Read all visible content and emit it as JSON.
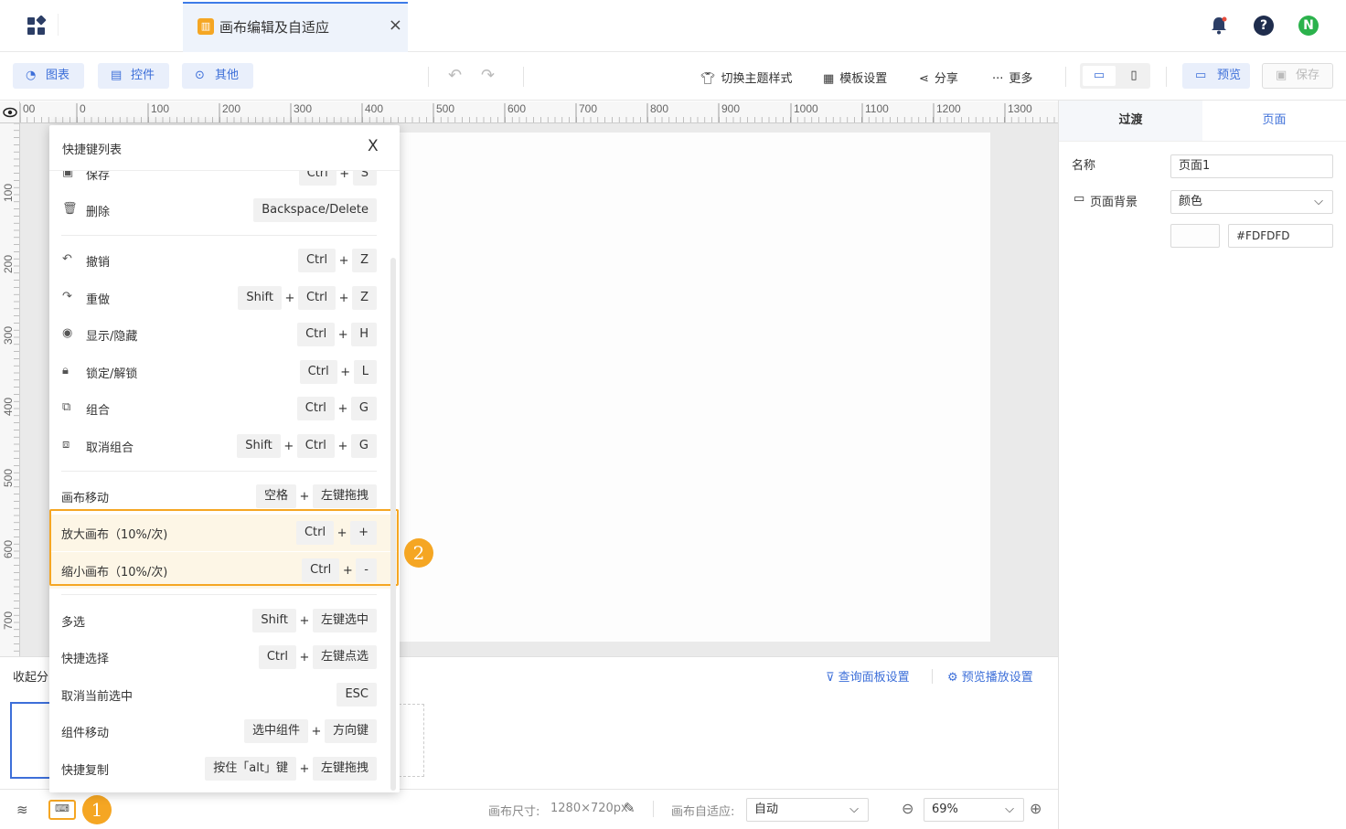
{
  "tab": {
    "title": "画布编辑及自适应",
    "close": "×"
  },
  "header_icons": {
    "user_initial": "N"
  },
  "toolbar": {
    "chart": "图表",
    "widget": "控件",
    "other": "其他",
    "theme": "切换主题样式",
    "template": "模板设置",
    "share": "分享",
    "more": "更多",
    "preview": "预览",
    "save": "保存"
  },
  "ruler": {
    "h_labels": [
      "00",
      "0",
      "100",
      "200",
      "300",
      "400",
      "500",
      "600",
      "700",
      "800",
      "900",
      "1000",
      "1100",
      "1200",
      "1300"
    ],
    "v_labels": [
      "100",
      "200",
      "300",
      "400",
      "500",
      "600",
      "700"
    ]
  },
  "popup": {
    "title": "快捷键列表",
    "close": "X",
    "rows": [
      {
        "label": "保存",
        "keys": [
          "Ctrl",
          "S"
        ]
      },
      {
        "label": "删除",
        "keys": [
          "Backspace/Delete"
        ]
      },
      {
        "label": "撤销",
        "keys": [
          "Ctrl",
          "Z"
        ]
      },
      {
        "label": "重做",
        "keys": [
          "Shift",
          "Ctrl",
          "Z"
        ]
      },
      {
        "label": "显示/隐藏",
        "keys": [
          "Ctrl",
          "H"
        ]
      },
      {
        "label": "锁定/解锁",
        "keys": [
          "Ctrl",
          "L"
        ]
      },
      {
        "label": "组合",
        "keys": [
          "Ctrl",
          "G"
        ]
      },
      {
        "label": "取消组合",
        "keys": [
          "Shift",
          "Ctrl",
          "G"
        ]
      },
      {
        "label": "画布移动",
        "keys": [
          "空格",
          "左键拖拽"
        ]
      },
      {
        "label": "放大画布（10%/次)",
        "keys": [
          "Ctrl",
          "+"
        ]
      },
      {
        "label": "缩小画布（10%/次)",
        "keys": [
          "Ctrl",
          "-"
        ]
      },
      {
        "label": "多选",
        "keys": [
          "Shift",
          "左键选中"
        ]
      },
      {
        "label": "快捷选择",
        "keys": [
          "Ctrl",
          "左键点选"
        ]
      },
      {
        "label": "取消当前选中",
        "keys": [
          "ESC"
        ]
      },
      {
        "label": "组件移动",
        "keys": [
          "选中组件",
          "方向键"
        ]
      },
      {
        "label": "快捷复制",
        "keys": [
          "按住「alt」键",
          "左键拖拽"
        ]
      }
    ],
    "plus": "+"
  },
  "badges": {
    "one": "1",
    "two": "2"
  },
  "page_panel": {
    "collapse": "收起分",
    "query_settings": "查询面板设置",
    "playback_settings": "预览播放设置"
  },
  "bottom_bar": {
    "canvas_size_label": "画布尺寸:",
    "canvas_size_value": "1280×720px",
    "adaptive_label": "画布自适应:",
    "adaptive_value": "自动",
    "zoom_value": "69%"
  },
  "right_panel": {
    "tab_transition": "过渡",
    "tab_page": "页面",
    "name_label": "名称",
    "name_value": "页面1",
    "bg_label": "页面背景",
    "bg_type": "颜色",
    "bg_color": "#FDFDFD"
  },
  "colors": {
    "accent": "#3d6fd9",
    "highlight": "#f5a623",
    "user": "#2bb24c"
  }
}
